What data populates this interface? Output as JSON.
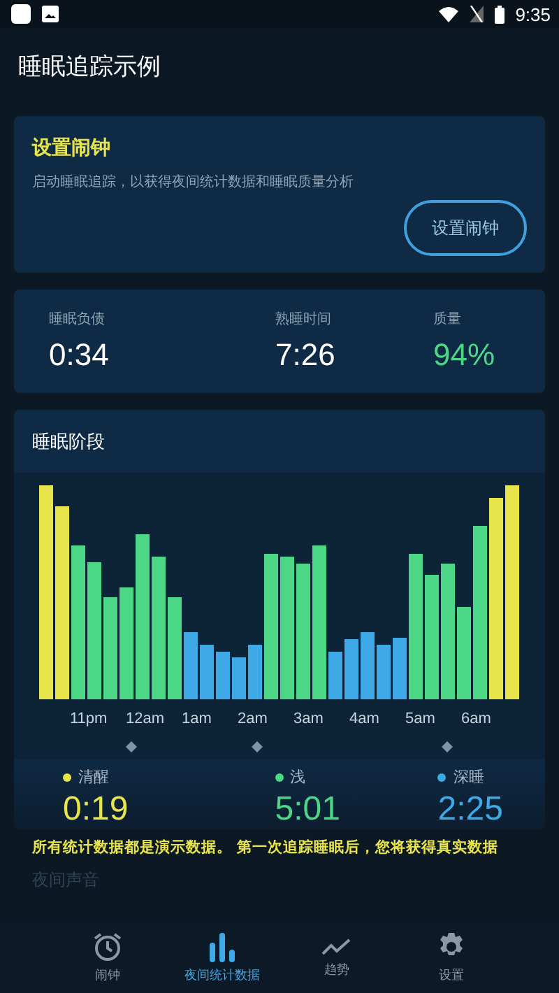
{
  "status_bar": {
    "time": "9:35"
  },
  "header": {
    "title": "睡眠追踪示例"
  },
  "alarm_card": {
    "title": "设置闹钟",
    "description": "启动睡眠追踪，以获得夜间统计数据和睡眠质量分析",
    "button": "设置闹钟"
  },
  "stats": [
    {
      "label": "睡眠负债",
      "value": "0:34",
      "kind": "plain"
    },
    {
      "label": "熟睡时间",
      "value": "7:26",
      "kind": "plain"
    },
    {
      "label": "质量",
      "value": "94%",
      "kind": "good"
    }
  ],
  "stages_card": {
    "title": "睡眠阶段",
    "time_labels": [
      "11pm",
      "12am",
      "1am",
      "2am",
      "3am",
      "4am",
      "5am",
      "6am"
    ],
    "legend": [
      {
        "label": "清醒",
        "value": "0:19",
        "color": "#e8e44c"
      },
      {
        "label": "浅",
        "value": "5:01",
        "color": "#4cd787"
      },
      {
        "label": "深睡",
        "value": "2:25",
        "color": "#3fa9e8"
      }
    ]
  },
  "notice": "所有统计数据都是演示数据。 第一次追踪睡眠后，您将获得真实数据",
  "section_hint": "夜间声音",
  "nav": [
    {
      "label": "闹钟",
      "kind": "alarm",
      "selected": false
    },
    {
      "label": "夜间统计数据",
      "kind": "stats",
      "selected": true
    },
    {
      "label": "趋势",
      "kind": "trend",
      "selected": false
    },
    {
      "label": "设置",
      "kind": "settings",
      "selected": false
    }
  ]
}
